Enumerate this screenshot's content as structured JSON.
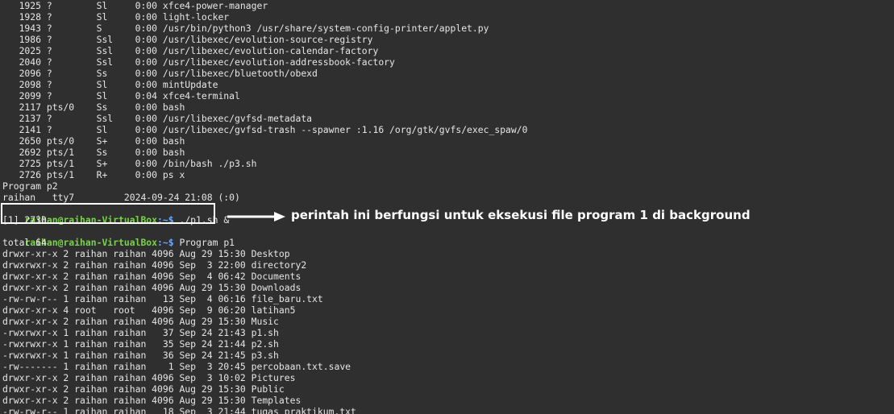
{
  "process_lines": [
    "   1925 ?        Sl     0:00 xfce4-power-manager",
    "   1928 ?        Sl     0:00 light-locker",
    "   1943 ?        S      0:00 /usr/bin/python3 /usr/share/system-config-printer/applet.py",
    "   1986 ?        Ssl    0:00 /usr/libexec/evolution-source-registry",
    "   2025 ?        Ssl    0:00 /usr/libexec/evolution-calendar-factory",
    "   2040 ?        Ssl    0:00 /usr/libexec/evolution-addressbook-factory",
    "   2096 ?        Ss     0:00 /usr/libexec/bluetooth/obexd",
    "   2098 ?        Sl     0:00 mintUpdate",
    "   2099 ?        Sl     0:04 xfce4-terminal",
    "   2117 pts/0    Ss     0:00 bash",
    "   2137 ?        Ssl    0:00 /usr/libexec/gvfsd-metadata",
    "   2141 ?        Sl     0:00 /usr/libexec/gvfsd-trash --spawner :1.16 /org/gtk/gvfs/exec_spaw/0",
    "   2650 pts/0    S+     0:00 bash",
    "   2692 pts/1    Ss     0:00 bash",
    "   2725 pts/1    S+     0:00 /bin/bash ./p3.sh",
    "   2726 pts/1    R+     0:00 ps x"
  ],
  "program_p2_header": "Program p2",
  "who_line": "raihan   tty7         2024-09-24 21:08 (:0)",
  "prompt": {
    "user_host": "raihan@raihan-VirtualBox",
    "path": ":~$"
  },
  "command_1": " ./p1.sh &",
  "job_line": "[1] 2730",
  "command_2": " Program p1",
  "total_line": "total 64",
  "ls_lines": [
    "drwxr-xr-x 2 raihan raihan 4096 Aug 29 15:30 Desktop",
    "drwxrwxr-x 2 raihan raihan 4096 Sep  3 22:00 directory2",
    "drwxr-xr-x 2 raihan raihan 4096 Sep  4 06:42 Documents",
    "drwxr-xr-x 2 raihan raihan 4096 Aug 29 15:30 Downloads",
    "-rw-rw-r-- 1 raihan raihan   13 Sep  4 06:16 file_baru.txt",
    "drwxr-xr-x 4 root   root   4096 Sep  9 06:20 latihan5",
    "drwxr-xr-x 2 raihan raihan 4096 Aug 29 15:30 Music",
    "-rwxrwxr-x 1 raihan raihan   37 Sep 24 21:43 p1.sh",
    "-rwxrwxr-x 1 raihan raihan   35 Sep 24 21:44 p2.sh",
    "-rwxrwxr-x 1 raihan raihan   36 Sep 24 21:45 p3.sh",
    "-rw------- 1 raihan raihan    1 Sep  3 20:45 percobaan.txt.save",
    "drwxr-xr-x 2 raihan raihan 4096 Sep  3 10:02 Pictures",
    "drwxr-xr-x 2 raihan raihan 4096 Aug 29 15:30 Public",
    "drwxr-xr-x 2 raihan raihan 4096 Aug 29 15:30 Templates",
    "-rw-rw-r-- 1 raihan raihan   18 Sep  3 21:44 tugas_praktikum.txt"
  ],
  "annotation": "perintah ini berfungsi untuk eksekusi file program 1 di background",
  "colors": {
    "background": "#2f2f2f",
    "text": "#e6e6e6",
    "prompt_user": "#7ad14c",
    "prompt_path": "#6aa8ff",
    "annotation": "#ffffff"
  }
}
